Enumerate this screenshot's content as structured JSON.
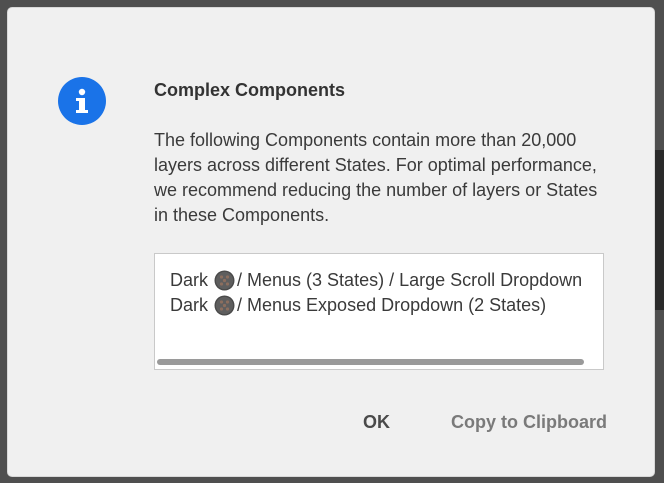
{
  "dialog": {
    "icon": "info-icon",
    "title": "Complex Components",
    "message": "The following Components contain more than 20,000 layers across different States. For optimal performance, we recommend reducing the number of layers or States in these Components.",
    "components": [
      {
        "prefix": "Dark",
        "icon": "component-library-icon",
        "path": "/ Menus (3 States) / Large Scroll Dropdown"
      },
      {
        "prefix": "Dark",
        "icon": "component-library-icon",
        "path": "/ Menus Exposed Dropdown (2 States)"
      }
    ],
    "horizontal_scroll_fraction": 0.95,
    "buttons": {
      "ok": "OK",
      "copy": "Copy to Clipboard"
    }
  },
  "colors": {
    "accent": "#1a73e8",
    "dialog_background": "#f0f0f0",
    "list_background": "#ffffff"
  }
}
